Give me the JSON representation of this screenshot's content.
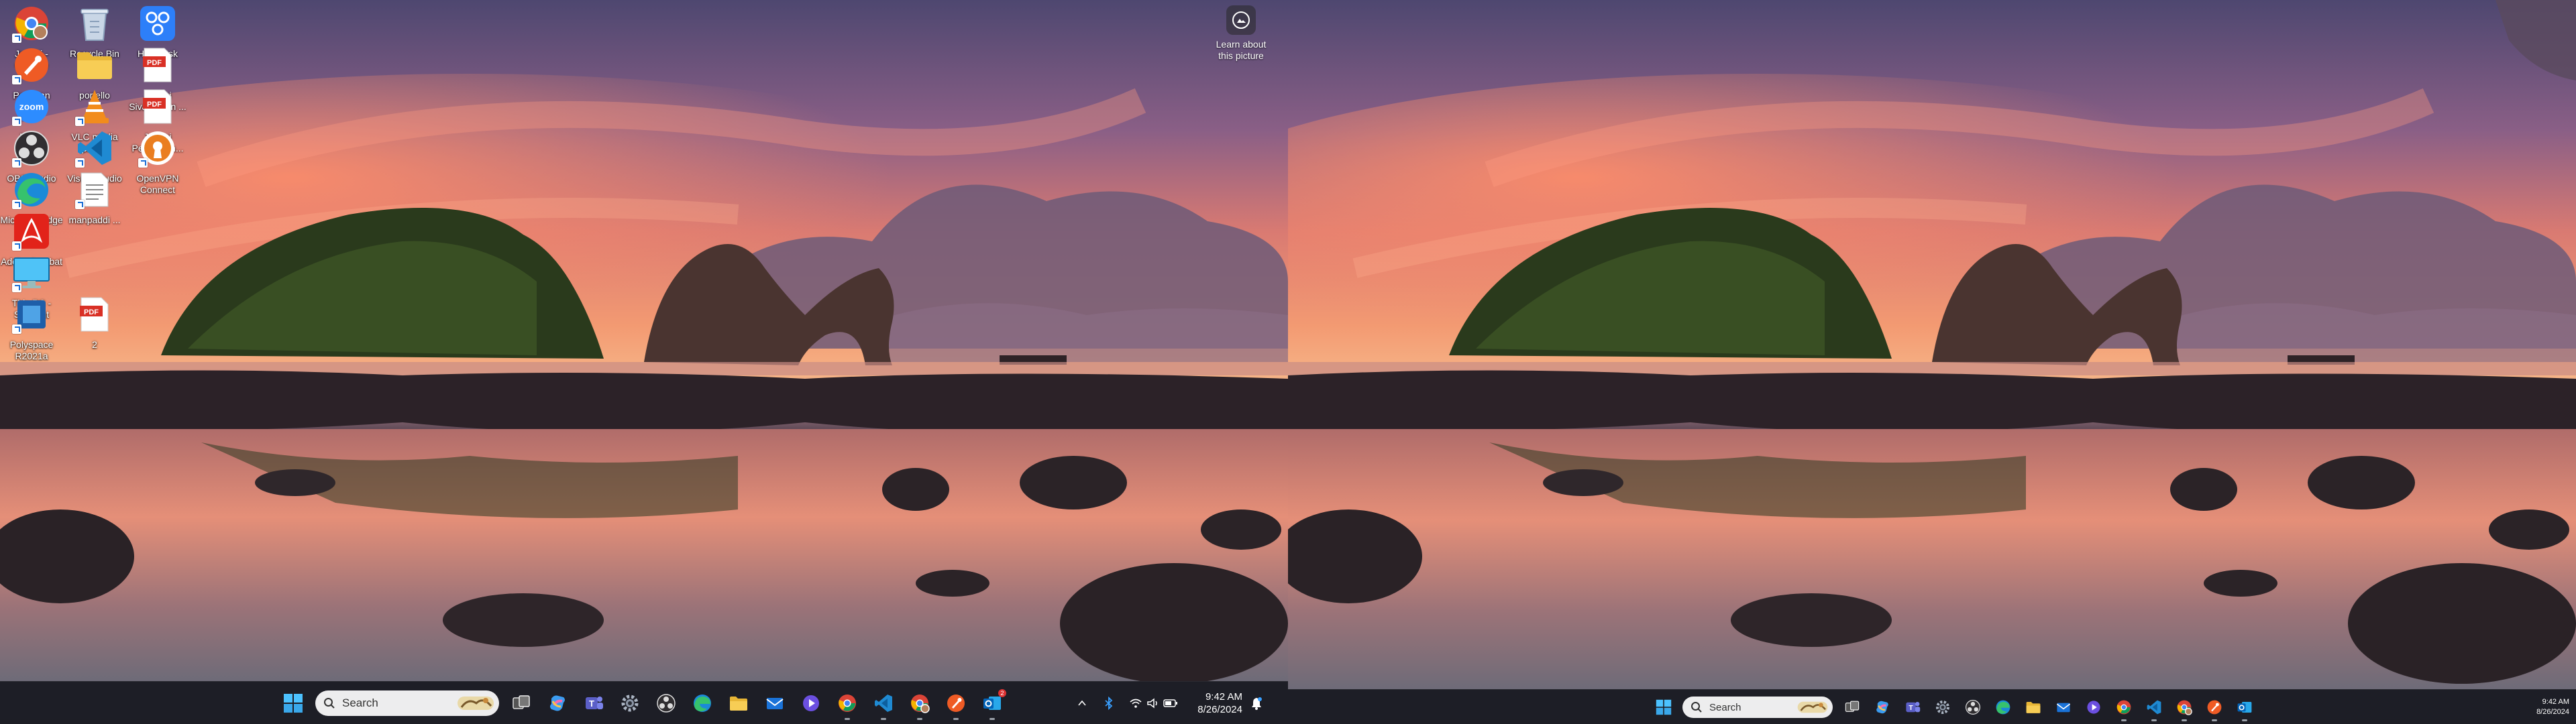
{
  "monitor1": {
    "desktop_icons": [
      {
        "name": "janani-chrome",
        "label": "Janani - Chrome",
        "icon": "chrome-icon",
        "shortcut": true
      },
      {
        "name": "recycle-bin",
        "label": "Recycle Bin",
        "icon": "recycle-bin-icon",
        "shortcut": false
      },
      {
        "name": "hivedesk",
        "label": "HiveDesk",
        "icon": "hivedesk-icon",
        "shortcut": false
      },
      {
        "name": "postman",
        "label": "Postman",
        "icon": "postman-icon",
        "shortcut": true
      },
      {
        "name": "portello",
        "label": "portello",
        "icon": "folder-icon",
        "shortcut": false
      },
      {
        "name": "janani-sivanathan-pdf",
        "label": "Janani Sivanathan ...",
        "icon": "pdf-icon",
        "shortcut": false
      },
      {
        "name": "zoom",
        "label": "Zoom",
        "icon": "zoom-icon",
        "shortcut": true
      },
      {
        "name": "vlc-media-player",
        "label": "VLC media player",
        "icon": "vlc-icon",
        "shortcut": true
      },
      {
        "name": "janani-performance-pdf",
        "label": "Janani Performan...",
        "icon": "pdf-icon",
        "shortcut": false
      },
      {
        "name": "obs-studio",
        "label": "OBS Studio",
        "icon": "obs-icon",
        "shortcut": true
      },
      {
        "name": "visual-studio-code",
        "label": "Visual Studio Code",
        "icon": "vscode-icon",
        "shortcut": true
      },
      {
        "name": "openvpn-connect",
        "label": "OpenVPN Connect",
        "icon": "openvpn-icon",
        "shortcut": true
      },
      {
        "name": "microsoft-edge",
        "label": "Microsoft Edge",
        "icon": "edge-icon",
        "shortcut": true
      },
      {
        "name": "manpaddi",
        "label": "manpaddi ...",
        "icon": "text-file-icon",
        "shortcut": false
      },
      {
        "name": "adobe-acrobat",
        "label": "Adobe Acrobat",
        "icon": "acrobat-icon",
        "shortcut": true
      },
      {
        "name": "this-pc-shortcut",
        "label": "This PC - Shortcut",
        "icon": "this-pc-icon",
        "shortcut": true
      },
      {
        "name": "polyspace",
        "label": "Polyspace R2021a",
        "icon": "polyspace-icon",
        "shortcut": true
      },
      {
        "name": "pdf-2",
        "label": "2",
        "icon": "pdf-icon",
        "shortcut": false
      }
    ],
    "learn_about": "Learn about this picture",
    "taskbar": {
      "search_placeholder": "Search",
      "apps": [
        {
          "name": "task-view",
          "icon": "task-view-icon",
          "running": false
        },
        {
          "name": "copilot",
          "icon": "copilot-icon",
          "running": false
        },
        {
          "name": "teams",
          "icon": "teams-icon",
          "running": false
        },
        {
          "name": "settings",
          "icon": "gear-icon",
          "running": false
        },
        {
          "name": "obs",
          "icon": "obs-icon",
          "running": false
        },
        {
          "name": "edge",
          "icon": "edge-icon",
          "running": false
        },
        {
          "name": "file-explorer",
          "icon": "folder-icon",
          "running": false
        },
        {
          "name": "mail",
          "icon": "mail-icon",
          "running": false
        },
        {
          "name": "media-player",
          "icon": "media-player-icon",
          "running": false
        },
        {
          "name": "chrome",
          "icon": "chrome-icon",
          "running": true
        },
        {
          "name": "vscode",
          "icon": "vscode-icon",
          "running": true
        },
        {
          "name": "chrome-profile",
          "icon": "chrome-icon",
          "running": true
        },
        {
          "name": "postman",
          "icon": "postman-icon",
          "running": true
        },
        {
          "name": "outlook",
          "icon": "outlook-icon",
          "running": true
        }
      ],
      "time": "9:42 AM",
      "date": "8/26/2024",
      "outlook_badge": "2"
    }
  },
  "monitor2": {
    "taskbar": {
      "search_placeholder": "Search",
      "time": "9:42 AM",
      "date": "8/26/2024"
    }
  },
  "colors": {
    "taskbar_bg": "#1c1e26",
    "sky_top": "#5a4f7a",
    "sky_glow": "#f07a5e",
    "horizon": "#f6a070"
  }
}
